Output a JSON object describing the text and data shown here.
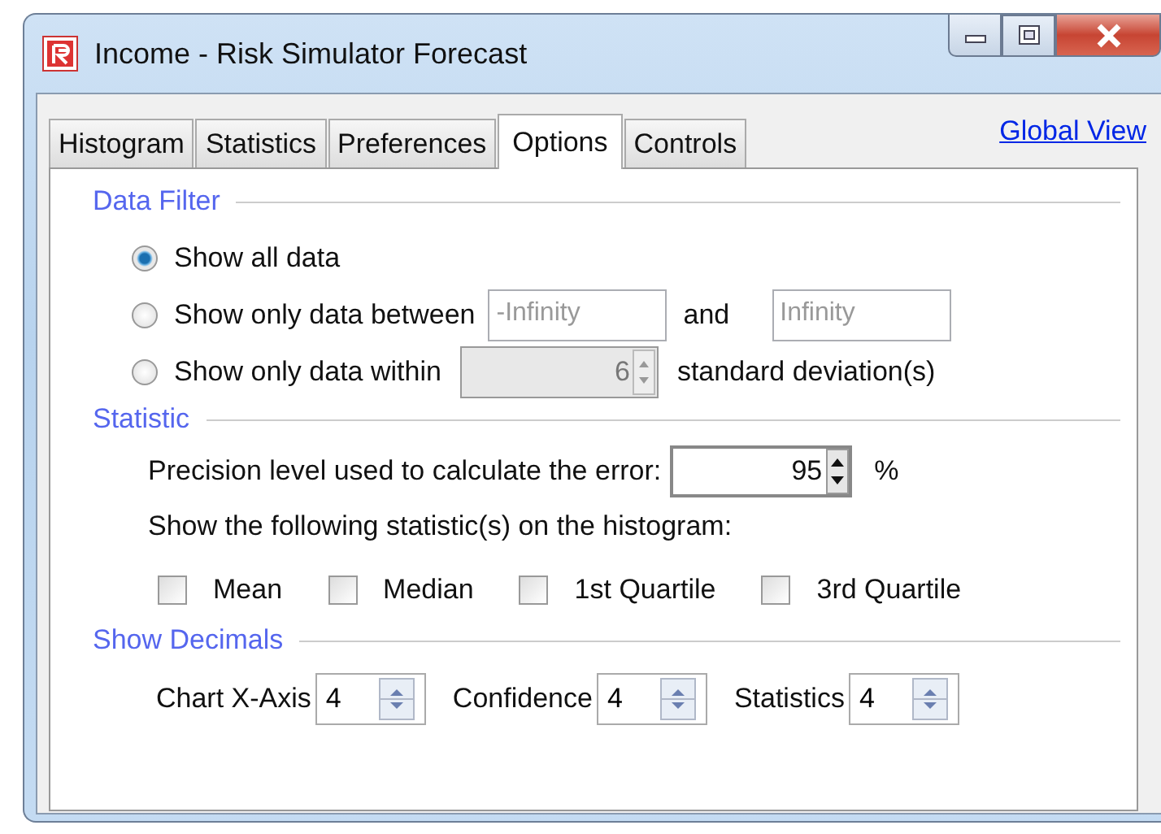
{
  "window": {
    "title": "Income - Risk Simulator Forecast"
  },
  "tabs": [
    {
      "label": "Histogram",
      "selected": false
    },
    {
      "label": "Statistics",
      "selected": false
    },
    {
      "label": "Preferences",
      "selected": false
    },
    {
      "label": "Options",
      "selected": true
    },
    {
      "label": "Controls",
      "selected": false
    }
  ],
  "global_view_link": "Global View",
  "data_filter": {
    "title": "Data Filter",
    "options": [
      {
        "kind": "plain",
        "label": "Show all data",
        "selected": true
      },
      {
        "kind": "range",
        "label": "Show only data between",
        "selected": false,
        "from": {
          "value": "-Infinity",
          "disabled": true
        },
        "joiner": "and",
        "to": {
          "value": "Infinity",
          "disabled": true
        }
      },
      {
        "kind": "spin",
        "label": "Show only data within",
        "selected": false,
        "field": {
          "value": "6",
          "disabled": true
        },
        "suffix": "standard deviation(s)"
      }
    ]
  },
  "statistic": {
    "title": "Statistic",
    "precision_label": "Precision level used to calculate the error:",
    "precision": {
      "value": "95",
      "disabled": false
    },
    "precision_unit": "%",
    "show_label": "Show the following statistic(s) on the histogram:",
    "checkboxes": [
      {
        "label": "Mean",
        "checked": false
      },
      {
        "label": "Median",
        "checked": false
      },
      {
        "label": "1st Quartile",
        "checked": false
      },
      {
        "label": "3rd Quartile",
        "checked": false
      }
    ]
  },
  "decimals": {
    "title": "Show Decimals",
    "spinners": [
      {
        "label": "Chart X-Axis",
        "value": "4"
      },
      {
        "label": "Confidence",
        "value": "4"
      },
      {
        "label": "Statistics",
        "value": "4"
      }
    ]
  }
}
